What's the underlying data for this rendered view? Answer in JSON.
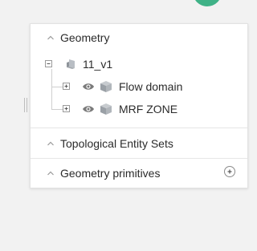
{
  "tree_panel": {
    "sections": {
      "geometry": {
        "title": "Geometry"
      },
      "topological_entity_sets": {
        "title": "Topological Entity Sets"
      },
      "geometry_primitives": {
        "title": "Geometry primitives"
      }
    },
    "tree": {
      "root": {
        "label": "11_v1",
        "icon": "part-icon",
        "expanded": true
      },
      "children": [
        {
          "label": "Flow domain",
          "icon": "solid-body-icon",
          "visible": true,
          "expanded": false
        },
        {
          "label": "MRF ZONE",
          "icon": "solid-body-icon",
          "visible": true,
          "expanded": false
        }
      ]
    }
  },
  "colors": {
    "avatar": "#3fb287",
    "panel_bg": "#ffffff",
    "page_bg": "#f2f2f2",
    "body_icon": "#9aa0a6"
  }
}
